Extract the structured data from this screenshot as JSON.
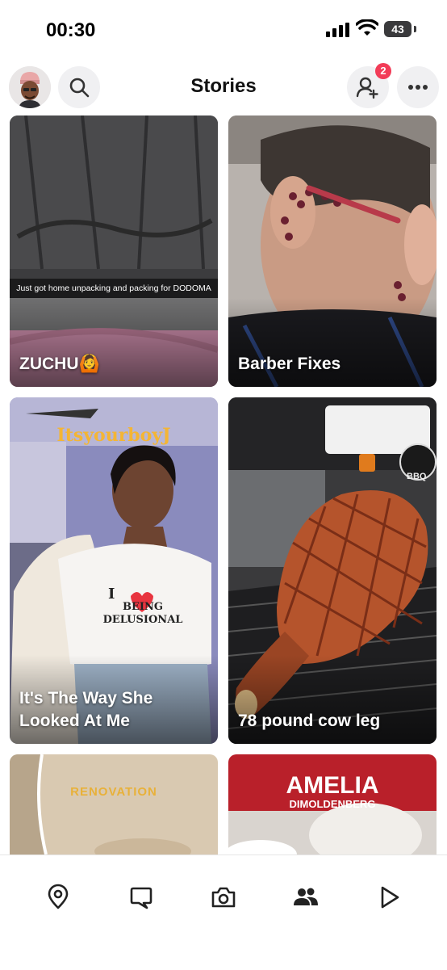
{
  "status_bar": {
    "time": "00:30",
    "battery": "43"
  },
  "header": {
    "title": "Stories",
    "friend_requests_badge": "2"
  },
  "stories": [
    {
      "label": "ZUCHU",
      "emoji": "🙆",
      "caption": "Just got home unpacking and packing for DODOMA"
    },
    {
      "label": "Barber Fixes"
    },
    {
      "label": "It's The Way She Looked At Me",
      "overlay_name": "ItsyourboyJ",
      "shirt_line1": "I",
      "shirt_line2": "BEING",
      "shirt_line3": "DELUSIONAL"
    },
    {
      "label": "78 pound cow leg",
      "sign_text": "BBQ"
    },
    {
      "label": "",
      "overlay_text": "RENOVATION"
    },
    {
      "label": "",
      "overlay_title": "AMELIA",
      "overlay_subtitle": "DIMOLDENBERG"
    }
  ],
  "bottom_nav": {
    "items": [
      "map",
      "chat",
      "camera",
      "stories",
      "spotlight"
    ],
    "icons": [
      "map-pin-icon",
      "chat-icon",
      "camera-icon",
      "friends-icon",
      "play-icon"
    ]
  },
  "colors": {
    "badge": "#f23c57",
    "title": "#111111",
    "nav_icon": "#222222"
  }
}
